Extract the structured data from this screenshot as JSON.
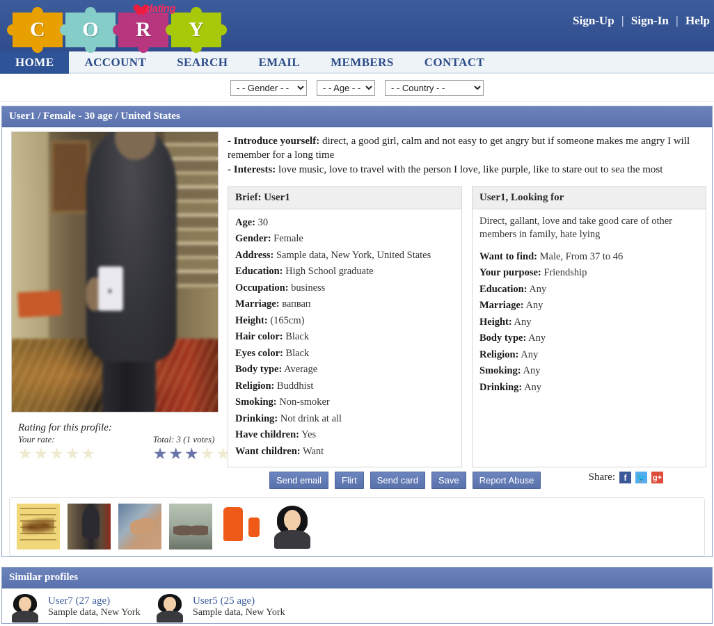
{
  "brand": {
    "letters": [
      "C",
      "O",
      "R",
      "Y"
    ],
    "tagline": "dating",
    "colors": {
      "piece1": "#e8a000",
      "piece2": "#85cdc8",
      "piece3": "#b8367e",
      "piece4": "#a8c90a",
      "header_bg": "#3a5896",
      "accent": "#6079b5"
    }
  },
  "top_links": {
    "sign_up": "Sign-Up",
    "sign_in": "Sign-In",
    "help": "Help",
    "separator": "|"
  },
  "nav": {
    "items": [
      {
        "label": "HOME",
        "active": true
      },
      {
        "label": "ACCOUNT",
        "active": false
      },
      {
        "label": "SEARCH",
        "active": false
      },
      {
        "label": "EMAIL",
        "active": false
      },
      {
        "label": "MEMBERS",
        "active": false
      },
      {
        "label": "CONTACT",
        "active": false
      }
    ]
  },
  "search": {
    "gender": {
      "selected": "- - Gender - -"
    },
    "age": {
      "selected": "- - Age - -"
    },
    "country": {
      "selected": "- - Country - -"
    }
  },
  "profile": {
    "header": "User1 / Female - 30 age / United States",
    "introduce_label": "- Introduce yourself:",
    "introduce_text": "direct, a good girl, calm and not easy to get angry but if someone makes me angry I will remember for a long time",
    "interests_label": "- Interests:",
    "interests_text": "love music, love to travel with the person I love, like purple, like to stare out to sea the most",
    "brief": {
      "title": "Brief: User1",
      "rows": [
        {
          "key": "Age:",
          "value": "30"
        },
        {
          "key": "Gender:",
          "value": "Female"
        },
        {
          "key": "Address:",
          "value": "Sample data, New York, United States"
        },
        {
          "key": "Education:",
          "value": "High School graduate"
        },
        {
          "key": "Occupation:",
          "value": "business"
        },
        {
          "key": "Marriage:",
          "value": "вапвап"
        },
        {
          "key": "Height:",
          "value": "(165cm)"
        },
        {
          "key": "Hair color:",
          "value": "Black"
        },
        {
          "key": "Eyes color:",
          "value": "Black"
        },
        {
          "key": "Body type:",
          "value": "Average"
        },
        {
          "key": "Religion:",
          "value": "Buddhist"
        },
        {
          "key": "Smoking:",
          "value": "Non-smoker"
        },
        {
          "key": "Drinking:",
          "value": "Not drink at all"
        },
        {
          "key": "Have children:",
          "value": "Yes"
        },
        {
          "key": "Want children:",
          "value": "Want"
        }
      ]
    },
    "looking_for": {
      "title": "User1, Looking for",
      "description": "Direct, gallant, love and take good care of other members in family, hate lying",
      "rows": [
        {
          "key": "Want to find:",
          "value": "Male, From 37 to 46"
        },
        {
          "key": "Your purpose:",
          "value": "Friendship"
        },
        {
          "key": "Education:",
          "value": "Any"
        },
        {
          "key": "Marriage:",
          "value": "Any"
        },
        {
          "key": "Height:",
          "value": "Any"
        },
        {
          "key": "Body type:",
          "value": "Any"
        },
        {
          "key": "Religion:",
          "value": "Any"
        },
        {
          "key": "Smoking:",
          "value": "Any"
        },
        {
          "key": "Drinking:",
          "value": "Any"
        }
      ]
    }
  },
  "rating": {
    "title": "Rating for this profile:",
    "your_rate_label": "Your rate:",
    "your_rate_stars": 0,
    "total_label": "Total: 3 (1 votes)",
    "total_stars": 3,
    "max_stars": 5,
    "star_full_color": "#6b74a8",
    "star_empty_color": "#efe9cf"
  },
  "actions": {
    "buttons": [
      {
        "label": "Send email"
      },
      {
        "label": "Flirt"
      },
      {
        "label": "Send card"
      },
      {
        "label": "Save"
      },
      {
        "label": "Report Abuse"
      }
    ],
    "share_label": "Share:",
    "share_icons": [
      {
        "name": "facebook-icon",
        "glyph": "f",
        "color": "#3b5998"
      },
      {
        "name": "twitter-icon",
        "glyph": "✈",
        "color": "#55acee"
      },
      {
        "name": "google-plus-icon",
        "glyph": "g+",
        "color": "#dd4b39"
      }
    ]
  },
  "gallery": {
    "thumbnails": [
      {
        "name": "thumbnail-calligraphy"
      },
      {
        "name": "thumbnail-person-mirror"
      },
      {
        "name": "thumbnail-hands"
      },
      {
        "name": "thumbnail-shoes"
      },
      {
        "name": "thumbnail-orange-shirts"
      },
      {
        "name": "thumbnail-avatar"
      }
    ]
  },
  "similar": {
    "title": "Similar profiles",
    "profiles": [
      {
        "name": "User7 (27 age)",
        "location": "Sample data, New York"
      },
      {
        "name": "User5 (25 age)",
        "location": "Sample data, New York"
      }
    ]
  }
}
